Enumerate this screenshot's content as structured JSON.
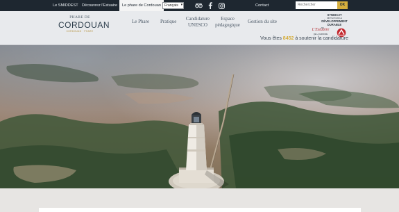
{
  "topbar": {
    "links": [
      "Le SMIDDEST",
      "Découvrez l'Estuaire",
      "Le phare de Cordouan"
    ],
    "language": "Français",
    "contact": "Contact",
    "search_placeholder": "Rechercher",
    "search_button": "OK"
  },
  "logo": {
    "line1": "PHARE DE",
    "line2": "CORDOUAN",
    "line3": "CORDOUAN · PHARE"
  },
  "nav": {
    "item1": "Le Phare",
    "item2": "Pratique",
    "item3a": "Candidature",
    "item3b": "UNESCO",
    "item4a": "Espace",
    "item4b": "pédagogique",
    "item5": "Gestion du site"
  },
  "syndicat": {
    "l1": "SYNDICAT",
    "l2": "MIXTE POUR LE",
    "l3": "DÉVELOPPEMENT",
    "l4": "DURABLE",
    "l5": "DE",
    "l6": "L'Estuaire",
    "l7": "DE LA GIRONDE"
  },
  "support": {
    "prefix": "Vous êtes",
    "count": "8452",
    "suffix": "à soutenir la candidature"
  },
  "colors": {
    "topbar": "#1e2730",
    "accent": "#d5ae3d",
    "header": "#e8eaed"
  }
}
